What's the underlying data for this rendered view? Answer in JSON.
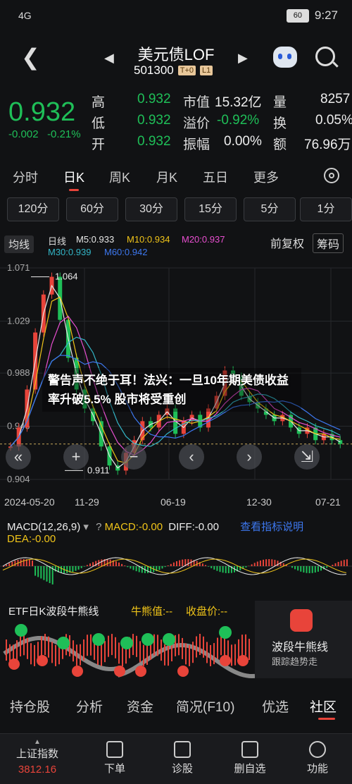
{
  "status": {
    "left": "4G",
    "time": "9:27",
    "battery": "60"
  },
  "nav": {
    "title": "美元债LOF",
    "code": "501300",
    "tag1": "T+0",
    "tag2": "L1"
  },
  "quote": {
    "price": "0.932",
    "change": "-0.002",
    "change_pct": "-0.21%",
    "labels": [
      "高",
      "低",
      "开",
      "市值",
      "溢价",
      "振幅",
      "量",
      "换",
      "额"
    ],
    "high": "0.932",
    "low": "0.932",
    "open": "0.932",
    "mktcap": "15.32亿",
    "premium": "-0.92%",
    "amplitude": "0.00%",
    "volume": "8257",
    "turnover": "0.05%",
    "amount": "76.96万"
  },
  "tabs": [
    "分时",
    "日K",
    "周K",
    "月K",
    "五日",
    "更多"
  ],
  "periods": [
    "120分",
    "60分",
    "30分",
    "15分",
    "5分",
    "1分"
  ],
  "chart_header": {
    "junxian": "均线",
    "rixian": "日线",
    "ma5": "M5:0.933",
    "ma10": "M10:0.934",
    "ma20": "M20:0.937",
    "ma30": "M30:0.939",
    "ma60": "M60:0.942",
    "fuquan": "前复权",
    "chouma": "筹码",
    "colors": {
      "ma5": "#e6e6e6",
      "ma10": "#f0c419",
      "ma20": "#e84fd0",
      "ma30": "#33b6c7",
      "ma60": "#3d78f0"
    }
  },
  "headline": "警告声不绝于耳！法兴：一旦10年期美债收益率升破5.5% 股市将受重创",
  "chart_data": {
    "type": "line",
    "x_ticks": [
      "2024-05-20",
      "11-29",
      "06-19",
      "12-30",
      "07-21"
    ],
    "y_ticks": [
      "1.071",
      "1.029",
      "0.988",
      "0.946",
      "0.904"
    ],
    "ylim": [
      0.904,
      1.071
    ],
    "annotations": [
      "1.064",
      "0.911"
    ],
    "series": [
      {
        "name": "",
        "values": [
          0.93,
          0.945,
          0.975,
          1.02,
          1.05,
          1.064,
          1.03,
          1.0,
          0.975,
          0.96,
          0.95,
          0.93,
          0.915,
          0.911,
          0.925,
          0.935,
          0.95,
          0.945,
          0.955,
          0.96,
          0.94,
          0.95,
          0.955,
          0.945,
          0.96,
          0.97,
          0.99,
          0.985,
          0.97,
          0.965,
          0.96,
          0.955,
          0.95,
          0.955,
          0.945,
          0.94,
          0.945,
          0.935,
          0.94,
          0.935,
          0.932
        ]
      }
    ]
  },
  "macd": {
    "title": "MACD(12,26,9)",
    "macd": "MACD:-0.00",
    "diff": "DIFF:-0.00",
    "link": "查看指标说明",
    "dea": "DEA:-0.00"
  },
  "etf": {
    "title": "ETF日K波段牛熊线",
    "bull_bear": "牛熊值:--",
    "wave": "收盘价:--",
    "card_title": "波段牛熊线",
    "card_sub": "跟踪趋势走"
  },
  "bottom_tabs": [
    "持仓股",
    "分析",
    "资金",
    "简况(F10)",
    "优选",
    "社区"
  ],
  "footer": {
    "index_name": "上证指数",
    "index_value": "3812.16",
    "items": [
      "下单",
      "诊股",
      "删自选",
      "功能"
    ]
  }
}
